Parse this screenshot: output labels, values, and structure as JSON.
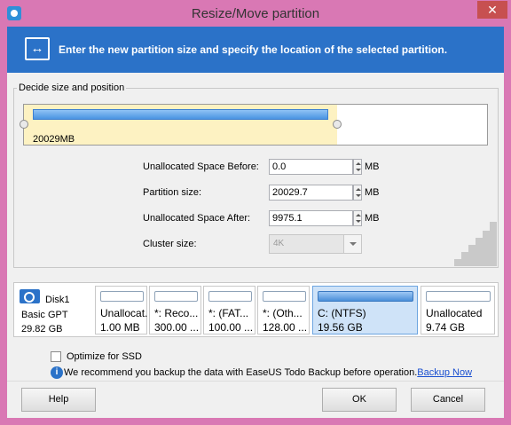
{
  "window": {
    "title": "Resize/Move partition",
    "close_glyph": "✕"
  },
  "banner": {
    "icon": "resize-arrows-icon",
    "text": "Enter the new partition size and specify the location of the selected partition."
  },
  "size_group": {
    "label": "Decide size and position",
    "bar_size_label": "20029MB",
    "used_fraction": 0.67
  },
  "fields": {
    "unallocated_before": {
      "label": "Unallocated Space Before:",
      "value": "0.0",
      "unit": "MB"
    },
    "partition_size": {
      "label": "Partition size:",
      "value": "20029.7",
      "unit": "MB"
    },
    "unallocated_after": {
      "label": "Unallocated Space After:",
      "value": "9975.1",
      "unit": "MB"
    },
    "cluster_size": {
      "label": "Cluster size:",
      "value": "4K"
    }
  },
  "disk": {
    "name": "Disk1",
    "type": "Basic GPT",
    "size": "29.82 GB",
    "partitions": [
      {
        "name": "Unallocat...",
        "size": "1.00 MB",
        "fill": false
      },
      {
        "name": "*: Reco...",
        "size": "300.00 ...",
        "fill": false
      },
      {
        "name": "*: (FAT...",
        "size": "100.00 ...",
        "fill": false
      },
      {
        "name": "*: (Oth...",
        "size": "128.00 ...",
        "fill": false
      },
      {
        "name": "C: (NTFS)",
        "size": "19.56 GB",
        "fill": true
      },
      {
        "name": "Unallocated",
        "size": "9.74 GB",
        "fill": false
      }
    ]
  },
  "ssd_option": {
    "label": "Optimize for SSD",
    "checked": false
  },
  "info": {
    "text": "We recommend you backup the data with EaseUS Todo Backup before operation.",
    "link": "Backup Now"
  },
  "buttons": {
    "help": "Help",
    "ok": "OK",
    "cancel": "Cancel"
  },
  "colors": {
    "banner": "#2b72c8",
    "frame": "#d978b4",
    "used_space": "#fdf2c2",
    "close": "#c75050"
  }
}
